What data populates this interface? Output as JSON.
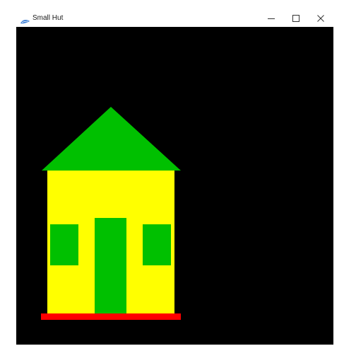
{
  "window": {
    "title": "Small Hut",
    "icon": "app-leaf-icon",
    "controls": {
      "minimize_icon": "minimize-icon",
      "maximize_icon": "maximize-icon",
      "close_icon": "close-icon"
    }
  },
  "scene": {
    "background": "#000000",
    "colors": {
      "roof": "#00c000",
      "walls": "#ffff00",
      "door": "#00c000",
      "windows": "#00c000",
      "base": "#ff0000"
    }
  }
}
